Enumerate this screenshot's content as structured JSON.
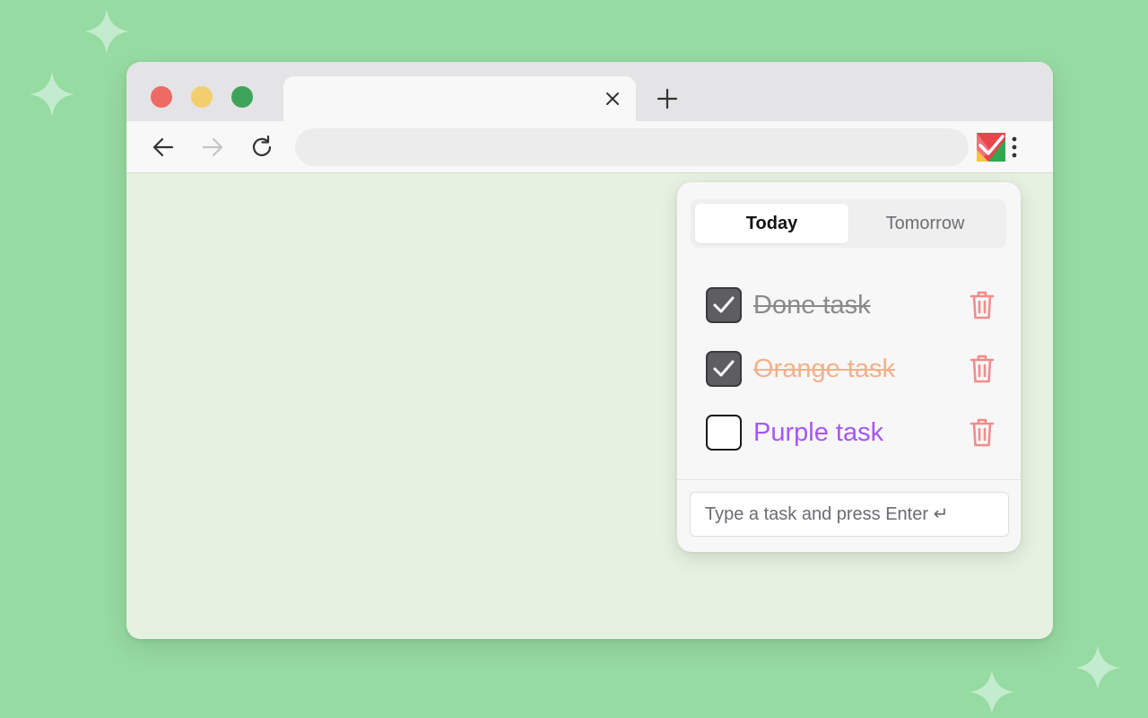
{
  "popup": {
    "tabs": [
      {
        "label": "Today",
        "active": true
      },
      {
        "label": "Tomorrow",
        "active": false
      }
    ],
    "tasks": [
      {
        "label": "Done task",
        "done": true,
        "color": "#8a8a8a"
      },
      {
        "label": "Orange task",
        "done": true,
        "color": "#f4b08a"
      },
      {
        "label": "Purple task",
        "done": false,
        "color": "#a855f7"
      }
    ],
    "input": {
      "placeholder": "Type a task and press Enter ↵",
      "value": ""
    }
  },
  "colors": {
    "background": "#96dba1",
    "page": "#e6f1e1",
    "trash": "#f28b8b",
    "checkbox_checked": "#5e5e62"
  },
  "icons": [
    "sparkle-icon",
    "close-icon",
    "plus-icon",
    "back-arrow-icon",
    "forward-arrow-icon",
    "reload-icon",
    "extension-checkmark-icon",
    "kebab-menu-icon",
    "checkmark-icon",
    "trash-icon"
  ]
}
